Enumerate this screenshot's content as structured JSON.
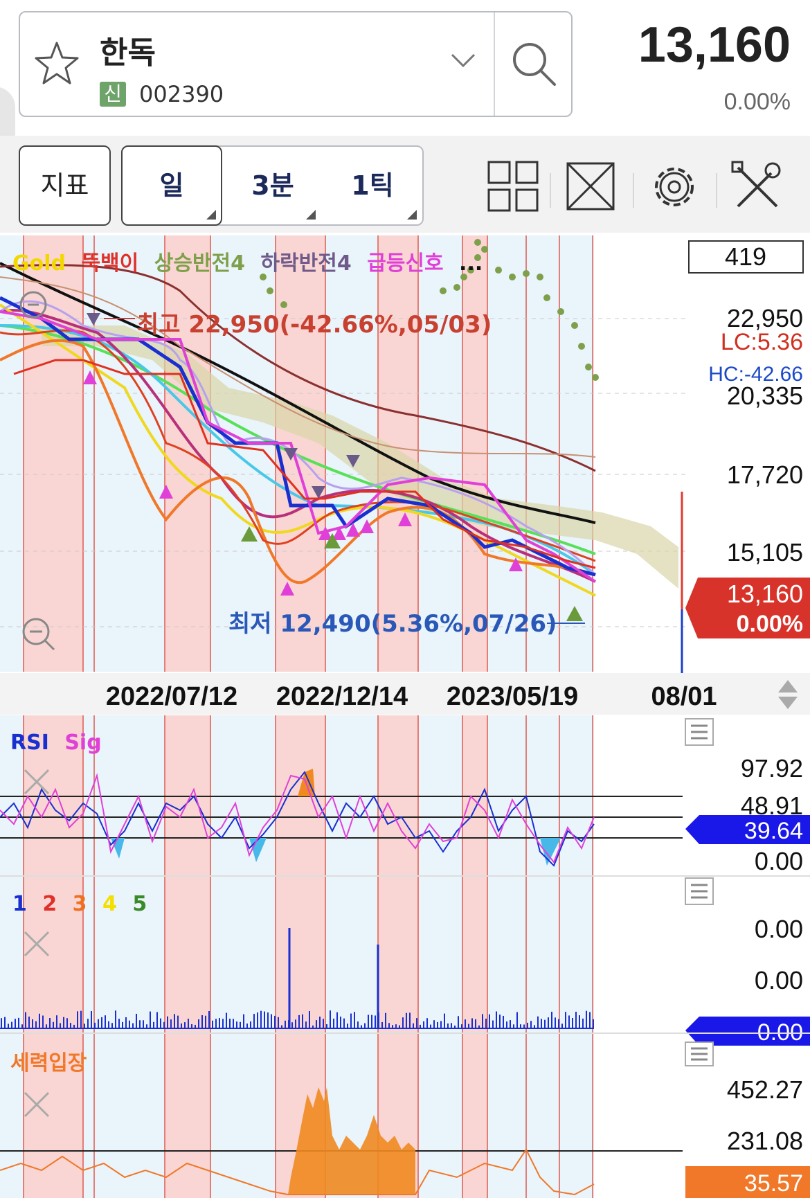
{
  "header": {
    "stock_name": "한독",
    "credit_badge": "신",
    "stock_code": "002390",
    "price": "13,160",
    "change": "0.00%"
  },
  "toolbar": {
    "indicator_label": "지표",
    "periods": [
      "일",
      "3분",
      "1틱"
    ],
    "icons": [
      "grid-layout-icon",
      "fullscreen-icon",
      "settings-icon",
      "tools-icon"
    ]
  },
  "main_chart": {
    "legend": [
      {
        "text": "Gold",
        "color": "#f3d800"
      },
      {
        "text": "뚝백이",
        "color": "#e0302a"
      },
      {
        "text": "상승반전4",
        "color": "#7fa04a"
      },
      {
        "text": "하락반전4",
        "color": "#6f5a8a"
      },
      {
        "text": "급등신호",
        "color": "#e040d8"
      },
      {
        "text": "...",
        "color": "#111111"
      }
    ],
    "high_annotation": "최고 22,950(-42.66%,05/03)",
    "low_annotation": "최저 12,490(5.36%,07/26)",
    "volume_box": "419",
    "y_labels": [
      "22,950",
      "20,335",
      "17,720",
      "15,105"
    ],
    "lc_label": "LC:5.36",
    "hc_label": "HC:-42.66",
    "price_tag": "13,160",
    "price_tag_pct": "0.00%",
    "dates": [
      "2022/07/12",
      "2022/12/14",
      "2023/05/19",
      "08/01"
    ],
    "colors": {
      "up": "#e03a2f",
      "down": "#1b3fc9",
      "accent": "#e0302a"
    }
  },
  "rsi_panel": {
    "title_rsi": "RSI",
    "title_sig": "Sig",
    "y_labels": [
      "97.92",
      "0.00"
    ],
    "value_tag": "39.64",
    "overlapped_label": "48.91"
  },
  "vol_panel": {
    "legend": [
      "1",
      "2",
      "3",
      "4",
      "5"
    ],
    "legend_colors": [
      "#1a2fd0",
      "#e0302a",
      "#f07020",
      "#f3e000",
      "#3a8a2a"
    ],
    "y_labels": [
      "0.00",
      "0.00"
    ],
    "value_tag": "0.00"
  },
  "force_panel": {
    "title": "세력입장",
    "y_labels": [
      "452.27",
      "231.08"
    ],
    "value_tag": "35.57"
  }
}
